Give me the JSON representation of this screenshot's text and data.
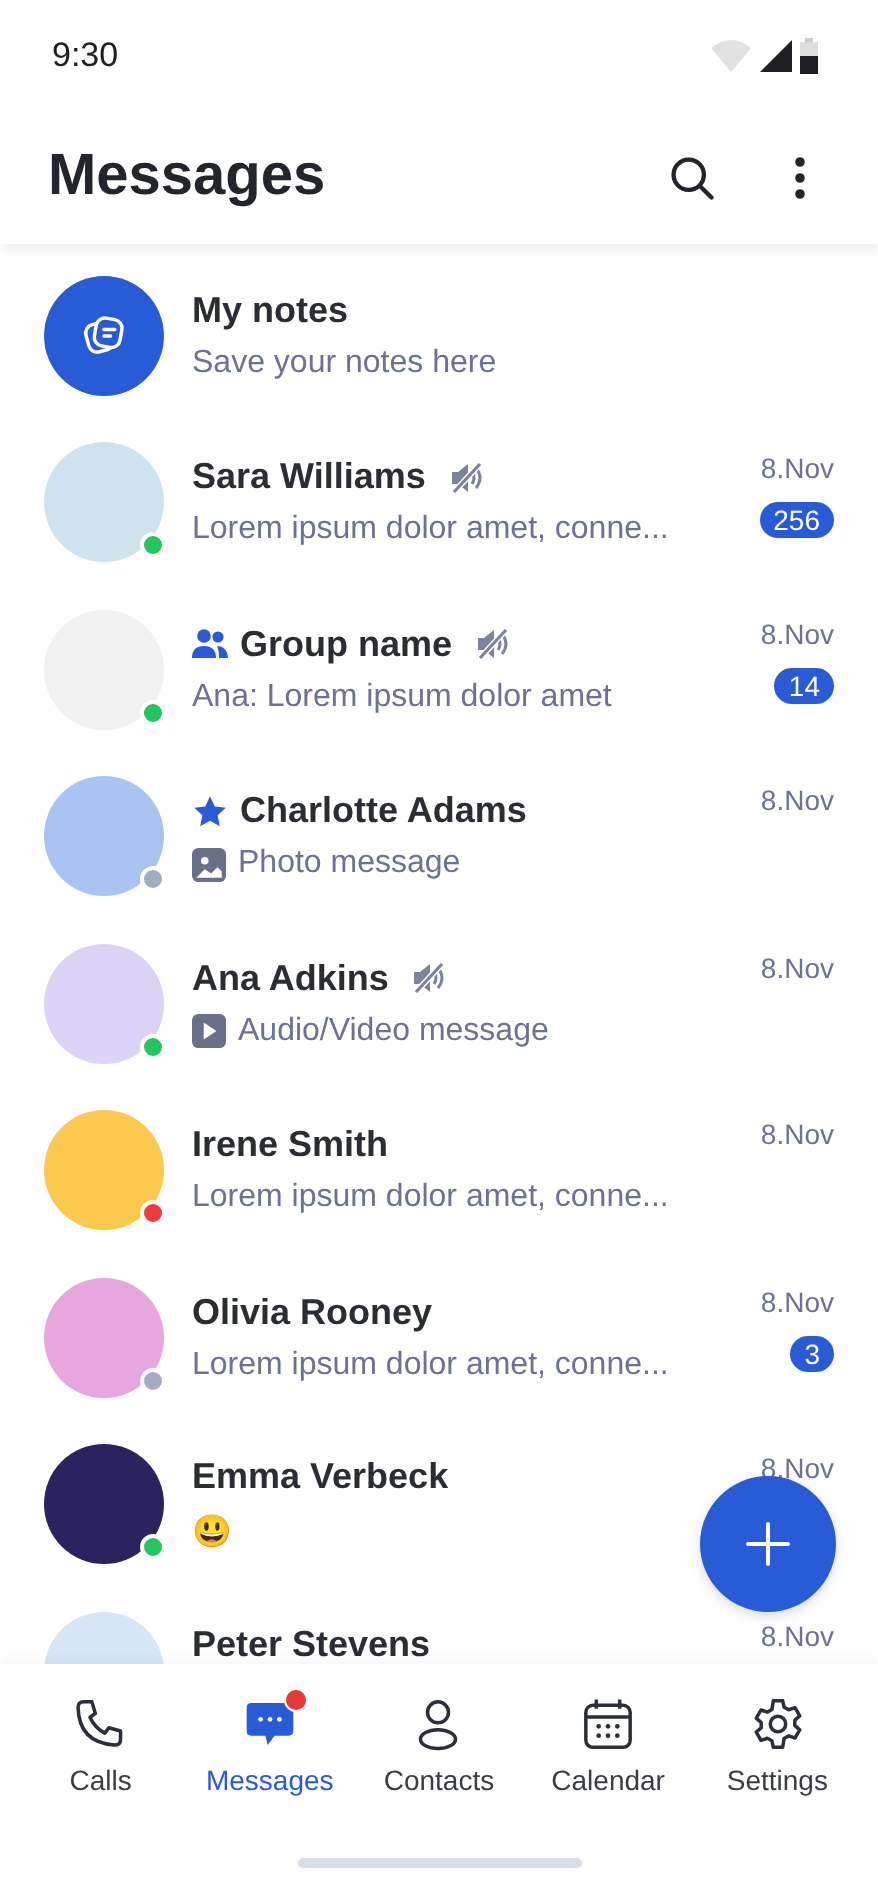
{
  "status_bar": {
    "time": "9:30"
  },
  "header": {
    "title": "Messages"
  },
  "chats": [
    {
      "kind": "notes",
      "name": "My notes",
      "preview": {
        "kind": "text",
        "text": "Save your notes here"
      }
    },
    {
      "kind": "person",
      "name": "Sara Williams",
      "muted": true,
      "preview": {
        "kind": "text",
        "text": "Lorem ipsum dolor amet, conne..."
      },
      "date": "8.Nov",
      "unread": "256",
      "color": "#22c55e"
    },
    {
      "kind": "group",
      "name": "Group name",
      "muted": true,
      "preview": {
        "kind": "text",
        "text": "Ana: Lorem ipsum dolor amet"
      },
      "date": "8.Nov",
      "unread": "14",
      "color": "#22c55e"
    },
    {
      "kind": "favorite",
      "name": "Charlotte Adams",
      "muted": false,
      "preview": {
        "kind": "photo",
        "text": "Photo message"
      },
      "date": "8.Nov",
      "color": "#a3adc2"
    },
    {
      "kind": "person",
      "name": "Ana Adkins",
      "muted": true,
      "preview": {
        "kind": "video",
        "text": "Audio/Video message"
      },
      "date": "8.Nov",
      "color": "#22c55e"
    },
    {
      "kind": "person",
      "name": "Irene Smith",
      "muted": false,
      "preview": {
        "kind": "text",
        "text": "Lorem ipsum dolor amet, conne..."
      },
      "date": "8.Nov",
      "color": "#ef3b3b"
    },
    {
      "kind": "person",
      "name": "Olivia Rooney",
      "muted": false,
      "preview": {
        "kind": "text",
        "text": "Lorem ipsum dolor amet, conne..."
      },
      "date": "8.Nov",
      "unread": "3",
      "color": "#a3adc2"
    },
    {
      "kind": "person",
      "name": "Emma Verbeck",
      "muted": false,
      "preview": {
        "kind": "text",
        "text": "😃"
      },
      "date": "8.Nov",
      "color": "#22c55e"
    },
    {
      "kind": "person",
      "name": "Peter Stevens",
      "muted": false,
      "date": "8.Nov"
    }
  ],
  "nav": [
    {
      "label": "Calls",
      "selected": false,
      "notification": false
    },
    {
      "label": "Messages",
      "selected": true,
      "notification": true
    },
    {
      "label": "Contacts",
      "selected": false,
      "notification": false
    },
    {
      "label": "Calendar",
      "selected": false,
      "notification": false
    },
    {
      "label": "Settings",
      "selected": false,
      "notification": false
    }
  ]
}
